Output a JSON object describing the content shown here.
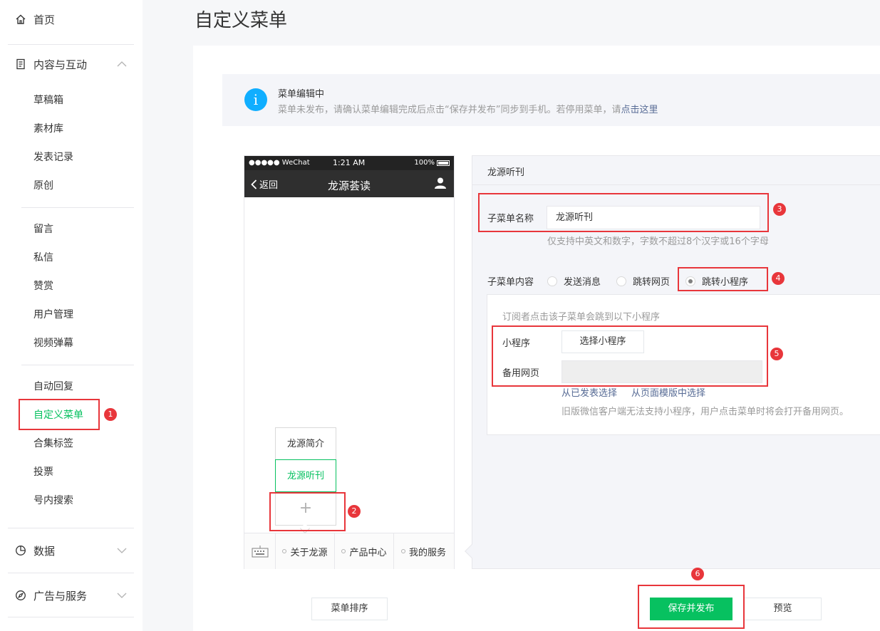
{
  "sidebar": {
    "home": "首页",
    "content_group": "内容与互动",
    "items_a": [
      "草稿箱",
      "素材库",
      "发表记录",
      "原创"
    ],
    "items_b": [
      "留言",
      "私信",
      "赞赏",
      "用户管理",
      "视频弹幕"
    ],
    "items_c": [
      "自动回复",
      "自定义菜单",
      "合集标签",
      "投票",
      "号内搜索"
    ],
    "data_group": "数据",
    "ads_group": "广告与服务"
  },
  "page": {
    "title": "自定义菜单"
  },
  "notice": {
    "title": "菜单编辑中",
    "desc": "菜单未发布，请确认菜单编辑完成后点击“保存并发布”同步到手机。若停用菜单，请",
    "link": "点击这里"
  },
  "phone": {
    "carrier": "●●●●● WeChat",
    "time": "1:21 AM",
    "battery": "100%",
    "back": "返回",
    "title": "龙源荟读",
    "tabs": [
      "关于龙源",
      "产品中心",
      "我的服务"
    ],
    "submenu": [
      "龙源简介",
      "龙源听刊"
    ],
    "add_symbol": "+"
  },
  "editor": {
    "header": "龙源听刊",
    "name_label": "子菜单名称",
    "name_value": "龙源听刊",
    "name_hint": "仅支持中英文和数字，字数不超过8个汉字或16个字母",
    "content_label": "子菜单内容",
    "radios": [
      "发送消息",
      "跳转网页",
      "跳转小程序"
    ],
    "mini_hint": "订阅者点击该子菜单会跳到以下小程序",
    "mini_label": "小程序",
    "mini_button": "选择小程序",
    "backup_label": "备用网页",
    "link_published": "从已发表选择",
    "link_template": "从页面模版中选择",
    "compat_hint": "旧版微信客户端无法支持小程序，用户点击菜单时将会打开备用网页。"
  },
  "buttons": {
    "sort": "菜单排序",
    "save": "保存并发布",
    "preview": "预览"
  },
  "annotations": [
    "1",
    "2",
    "3",
    "4",
    "5",
    "6"
  ],
  "colors": {
    "accent": "#07c160",
    "annotation": "#e8363b",
    "info": "#10aeff",
    "link": "#576b95"
  }
}
